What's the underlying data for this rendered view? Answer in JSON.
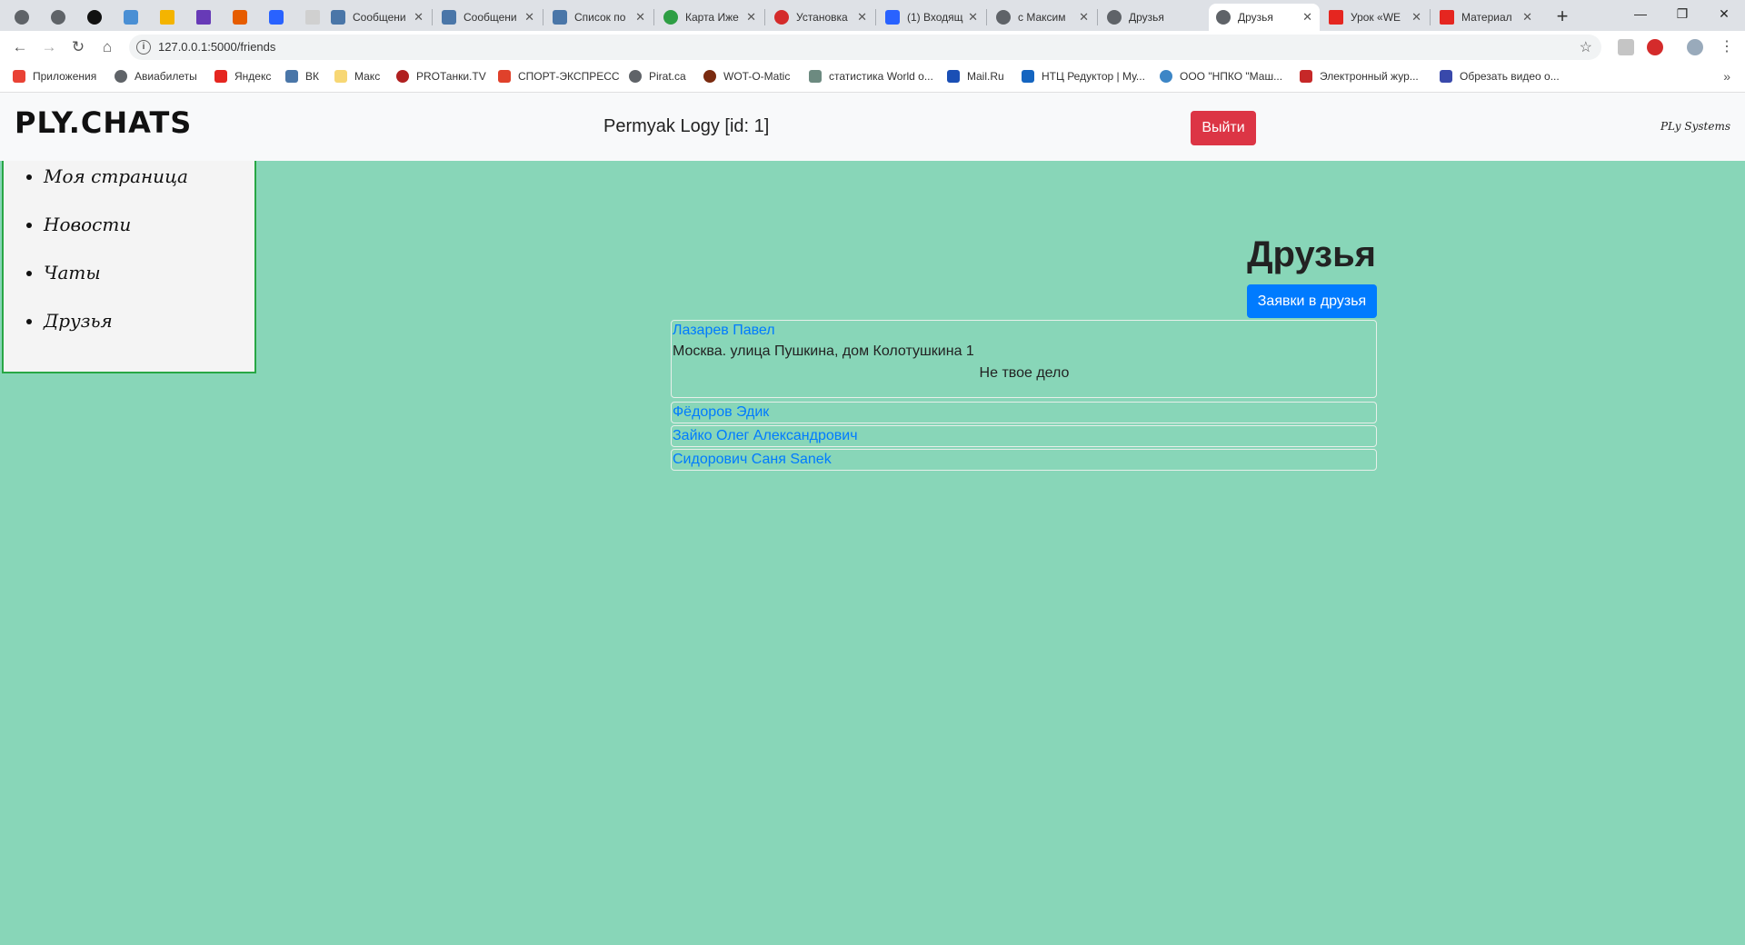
{
  "browser": {
    "tabs": [
      {
        "label": "Сообщени",
        "pinned": false
      },
      {
        "label": "Сообщени",
        "pinned": false
      },
      {
        "label": "Список по",
        "pinned": false
      },
      {
        "label": "Карта Иже",
        "pinned": false
      },
      {
        "label": "Установка",
        "pinned": false
      },
      {
        "label": "(1) Входящ",
        "pinned": false
      },
      {
        "label": "с Максим",
        "pinned": false
      },
      {
        "label": "Друзья",
        "pinned": false
      },
      {
        "label": "Друзья",
        "pinned": false,
        "active": true
      },
      {
        "label": "Урок «WE",
        "pinned": false
      },
      {
        "label": "Материал",
        "pinned": false
      }
    ],
    "url": "127.0.0.1:5000/friends",
    "bookmarks": [
      "Приложения",
      "Авиабилеты",
      "Яндекс",
      "ВК",
      "Макс",
      "PROТанки.TV",
      "СПОРТ-ЭКСПРЕСС",
      "Pirat.ca",
      "WOT-O-Matic",
      "статистика World o...",
      "Mail.Ru",
      "НТЦ Редуктор | Му...",
      "ООО \"НПКО \"Маш...",
      "Электронный жур...",
      "Обрезать видео о..."
    ]
  },
  "header": {
    "logo": "PLY.CHATS",
    "user": "Permyak Logy [id: 1]",
    "logout_label": "Выйти",
    "brand": "PLy Systems"
  },
  "sidebar": {
    "items": [
      {
        "label": "Моя страница"
      },
      {
        "label": "Новости"
      },
      {
        "label": "Чаты"
      },
      {
        "label": "Друзья"
      }
    ]
  },
  "main": {
    "title": "Друзья",
    "requests_label": "Заявки в друзья",
    "friends": [
      {
        "name": "Лазарев Павел",
        "address": "Москва. улица Пушкина, дом Колотушкина 1",
        "about": "Не твое дело"
      },
      {
        "name": "Фёдоров Эдик"
      },
      {
        "name": "Зайко Олег Александрович"
      },
      {
        "name": "Сидорович Саня Sanek"
      }
    ]
  },
  "colors": {
    "page_bg": "#88d6b8",
    "logout": "#dc3545",
    "primary": "#007bff",
    "sidebar_border": "#28a745"
  }
}
